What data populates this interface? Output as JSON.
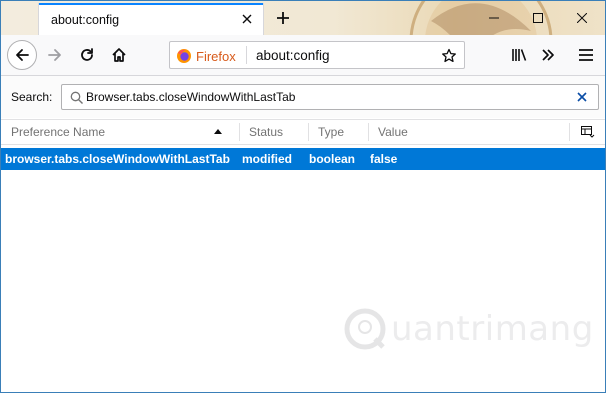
{
  "tab": {
    "title": "about:config"
  },
  "urlbar": {
    "identity_label": "Firefox",
    "url": "about:config"
  },
  "search": {
    "label": "Search:",
    "value": "Browser.tabs.closeWindowWithLastTab"
  },
  "table": {
    "columns": [
      "Preference Name",
      "Status",
      "Type",
      "Value"
    ],
    "rows": [
      {
        "name": "browser.tabs.closeWindowWithLastTab",
        "status": "modified",
        "type": "boolean",
        "value": "false"
      }
    ]
  },
  "watermark": {
    "text": "uantrimang"
  },
  "colors": {
    "accent": "#0a84ff",
    "selection": "#0078d7",
    "firefox_orange": "#d85a1a"
  },
  "icons": {
    "back": "arrow-left-icon",
    "forward": "arrow-right-icon",
    "reload": "reload-icon",
    "home": "home-icon",
    "bookmark": "star-icon",
    "library": "library-icon",
    "overflow": "chevron-double-right-icon",
    "menu": "hamburger-menu-icon"
  }
}
